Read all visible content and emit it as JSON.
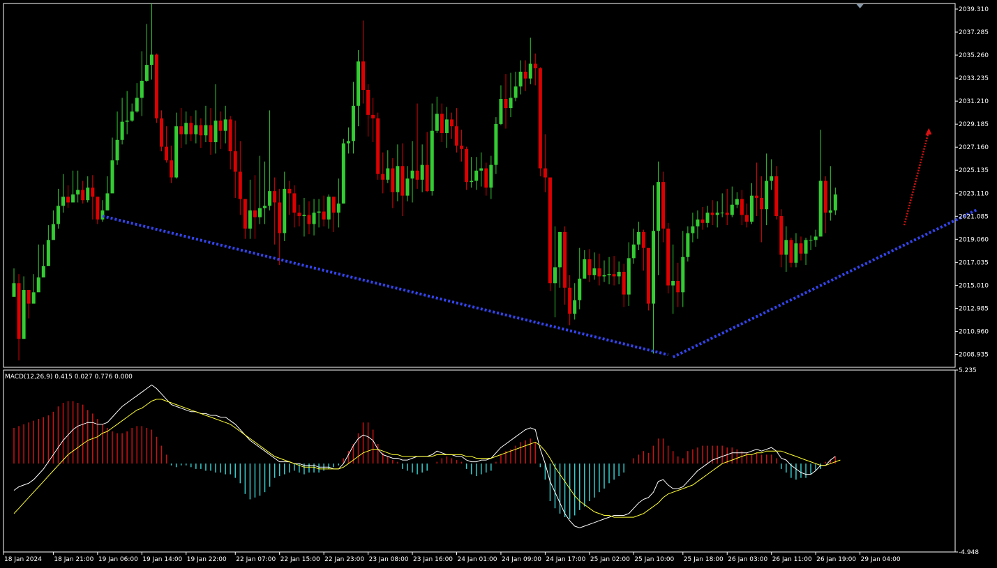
{
  "colors": {
    "background": "#000000",
    "frame": "#ffffff",
    "bull": "#33cc33",
    "bear": "#dd0000",
    "trendline": "#3344ee",
    "projection": "#dd1111",
    "macd_pos": "#cc1111",
    "macd_neg": "#33cccc",
    "macd_line": "#ffffff",
    "signal_line": "#ffff33"
  },
  "indicator": {
    "title": "MACD(12,26,9) 0.415 0.027 0.776 0.000"
  },
  "chart_data": [
    {
      "type": "candlestick",
      "symbol": "",
      "ylim": [
        2007.8,
        2039.8
      ],
      "yticks": [
        "2039.310",
        "2037.285",
        "2035.260",
        "2033.235",
        "2031.210",
        "2029.185",
        "2027.160",
        "2025.135",
        "2023.110",
        "2021.085",
        "2019.060",
        "2017.035",
        "2015.010",
        "2012.985",
        "2010.960",
        "2008.935"
      ],
      "xticks": [
        "18 Jan 2024",
        "18 Jan 21:00",
        "19 Jan 06:00",
        "19 Jan 14:00",
        "19 Jan 22:00",
        "22 Jan 07:00",
        "22 Jan 15:00",
        "22 Jan 23:00",
        "23 Jan 08:00",
        "23 Jan 16:00",
        "24 Jan 01:00",
        "24 Jan 09:00",
        "24 Jan 17:00",
        "25 Jan 02:00",
        "25 Jan 10:00",
        "25 Jan 18:00",
        "26 Jan 03:00",
        "26 Jan 11:00",
        "26 Jan 19:00",
        "29 Jan 04:00"
      ],
      "closes": [
        2015.2,
        2010.3,
        2014.6,
        2013.4,
        2014.4,
        2015.7,
        2016.7,
        2019.0,
        2020.4,
        2022.0,
        2022.8,
        2022.3,
        2023.0,
        2023.4,
        2022.5,
        2023.6,
        2022.8,
        2020.8,
        2021.6,
        2023.1,
        2026.0,
        2027.8,
        2029.4,
        2029.5,
        2030.3,
        2031.5,
        2033.0,
        2034.4,
        2035.3,
        2029.7,
        2027.2,
        2026.0,
        2024.5,
        2029.0,
        2028.3,
        2029.3,
        2028.3,
        2029.1,
        2028.2,
        2029.1,
        2027.6,
        2029.5,
        2028.6,
        2029.6,
        2026.8,
        2025.0,
        2022.6,
        2020.0,
        2021.6,
        2021.0,
        2021.8,
        2022.0,
        2023.3,
        2022.3,
        2019.6,
        2023.5,
        2023.1,
        2021.4,
        2021.1,
        2021.2,
        2020.4,
        2021.4,
        2021.5,
        2020.8,
        2022.8,
        2021.4,
        2022.2,
        2027.5,
        2027.7,
        2030.8,
        2034.7,
        2032.2,
        2030.0,
        2029.7,
        2024.8,
        2024.3,
        2025.3,
        2023.2,
        2025.5,
        2022.9,
        2024.4,
        2025.1,
        2024.3,
        2025.6,
        2023.3,
        2028.6,
        2030.1,
        2028.4,
        2029.6,
        2029.0,
        2027.3,
        2027.0,
        2024.1,
        2024.2,
        2025.1,
        2025.3,
        2023.6,
        2025.6,
        2029.2,
        2031.4,
        2030.6,
        2031.5,
        2032.5,
        2033.8,
        2033.2,
        2034.5,
        2034.1,
        2025.3,
        2024.5,
        2015.2,
        2016.6,
        2019.7,
        2014.8,
        2012.5,
        2013.7,
        2015.6,
        2017.3,
        2015.9,
        2016.5,
        2015.8,
        2015.9,
        2016.0,
        2015.8,
        2016.2,
        2014.2,
        2017.4,
        2018.6,
        2019.7,
        2018.3,
        2013.4,
        2019.8,
        2024.1,
        2020.0,
        2015.0,
        2015.4,
        2014.4,
        2017.5,
        2019.6,
        2020.2,
        2020.8,
        2020.5,
        2021.4,
        2021.2,
        2021.4,
        2021.4,
        2021.2,
        2022.1,
        2022.6,
        2021.2,
        2020.6,
        2022.9,
        2022.7,
        2021.7,
        2024.2,
        2024.6,
        2021.1,
        2017.7,
        2019.0,
        2017.0,
        2018.7,
        2017.8,
        2019.0,
        2019.0,
        2019.3,
        2024.2,
        2021.4,
        2021.6,
        2023.0
      ],
      "highs": [
        2016.5,
        2016.0,
        2015.8,
        2014.5,
        2016.0,
        2018.6,
        2018.6,
        2020.3,
        2021.6,
        2023.5,
        2024.8,
        2023.8,
        2025.1,
        2025.1,
        2024.2,
        2024.6,
        2024.7,
        2022.8,
        2022.5,
        2024.6,
        2028.0,
        2030.3,
        2031.5,
        2032.1,
        2031.0,
        2032.8,
        2035.6,
        2038.0,
        2039.8,
        2035.4,
        2030.4,
        2029.0,
        2027.3,
        2030.2,
        2030.6,
        2030.3,
        2029.9,
        2030.4,
        2029.7,
        2030.8,
        2030.6,
        2032.7,
        2030.3,
        2030.8,
        2029.9,
        2029.5,
        2027.7,
        2022.5,
        2024.3,
        2024.7,
        2026.4,
        2025.9,
        2030.4,
        2024.5,
        2023.5,
        2025.0,
        2024.2,
        2023.8,
        2022.1,
        2022.7,
        2022.4,
        2022.6,
        2022.6,
        2022.9,
        2023.0,
        2022.8,
        2024.4,
        2027.9,
        2028.9,
        2032.9,
        2035.7,
        2038.3,
        2032.7,
        2031.5,
        2030.2,
        2026.7,
        2026.9,
        2026.2,
        2027.4,
        2027.5,
        2025.5,
        2027.7,
        2031.0,
        2027.4,
        2028.5,
        2031.0,
        2031.6,
        2031.0,
        2030.7,
        2030.2,
        2030.6,
        2028.7,
        2027.2,
        2026.3,
        2026.3,
        2026.7,
        2025.8,
        2026.4,
        2029.8,
        2032.6,
        2033.6,
        2033.7,
        2033.8,
        2034.8,
        2034.8,
        2036.8,
        2035.4,
        2034.2,
        2028.3,
        2018.0,
        2020.2,
        2019.7,
        2020.2,
        2015.9,
        2015.2,
        2018.3,
        2018.1,
        2018.2,
        2017.9,
        2017.8,
        2017.2,
        2017.5,
        2017.6,
        2017.1,
        2016.9,
        2018.8,
        2020.0,
        2020.6,
        2019.9,
        2017.3,
        2023.8,
        2025.9,
        2025.0,
        2020.5,
        2018.6,
        2017.0,
        2019.8,
        2020.2,
        2021.4,
        2021.6,
        2021.9,
        2022.0,
        2022.5,
        2022.4,
        2023.1,
        2023.5,
        2023.7,
        2023.2,
        2023.4,
        2022.2,
        2024.0,
        2025.8,
        2024.6,
        2026.6,
        2026.1,
        2025.5,
        2021.7,
        2020.2,
        2019.2,
        2019.6,
        2019.3,
        2019.2,
        2019.4,
        2019.9,
        2028.7,
        2024.6,
        2025.5,
        2023.6
      ],
      "lows": [
        2014.3,
        2008.4,
        2010.3,
        2012.1,
        2013.6,
        2014.5,
        2016.3,
        2018.6,
        2019.9,
        2020.0,
        2021.4,
        2021.8,
        2022.5,
        2022.3,
        2022.2,
        2022.3,
        2020.8,
        2020.4,
        2020.6,
        2021.6,
        2023.4,
        2025.6,
        2027.4,
        2028.3,
        2029.4,
        2030.2,
        2029.9,
        2032.9,
        2033.1,
        2029.3,
        2026.8,
        2025.8,
        2024.0,
        2024.4,
        2027.1,
        2027.4,
        2027.7,
        2027.5,
        2027.1,
        2027.6,
        2026.5,
        2026.6,
        2027.0,
        2027.5,
        2025.2,
        2022.7,
        2021.2,
        2019.1,
        2019.1,
        2019.1,
        2020.4,
        2020.4,
        2021.6,
        2018.6,
        2016.8,
        2018.9,
        2021.2,
        2020.1,
        2020.2,
        2019.3,
        2019.5,
        2019.4,
        2020.1,
        2020.2,
        2020.0,
        2019.7,
        2020.1,
        2022.2,
        2026.6,
        2026.6,
        2029.0,
        2031.0,
        2028.1,
        2027.6,
        2024.3,
        2023.1,
        2024.0,
        2021.8,
        2022.4,
        2021.1,
        2022.4,
        2022.3,
        2023.5,
        2023.2,
        2023.2,
        2022.9,
        2028.4,
        2027.6,
        2027.1,
        2027.9,
        2026.7,
        2025.9,
        2023.4,
        2023.6,
        2023.4,
        2023.7,
        2022.9,
        2022.6,
        2024.8,
        2029.1,
        2028.8,
        2029.8,
        2031.2,
        2031.8,
        2032.1,
        2032.7,
        2032.6,
        2024.6,
        2023.2,
        2014.5,
        2012.2,
        2014.8,
        2013.3,
        2011.5,
        2012.0,
        2012.9,
        2016.0,
        2015.3,
        2015.5,
        2015.0,
        2015.3,
        2015.1,
        2015.0,
        2015.1,
        2013.1,
        2013.2,
        2016.9,
        2018.1,
        2016.3,
        2012.8,
        2009.0,
        2015.9,
        2018.8,
        2014.3,
        2012.5,
        2013.1,
        2013.1,
        2017.1,
        2018.8,
        2019.1,
        2019.9,
        2020.1,
        2020.3,
        2020.1,
        2021.0,
        2020.3,
        2021.0,
        2021.8,
        2020.3,
        2020.1,
        2020.4,
        2021.1,
        2018.8,
        2020.3,
        2023.4,
        2020.8,
        2016.6,
        2016.2,
        2016.6,
        2016.6,
        2017.2,
        2016.8,
        2018.1,
        2018.4,
        2019.3,
        2019.6,
        2020.7,
        2021.2
      ]
    },
    {
      "type": "bar",
      "name": "MACD(12,26,9)",
      "ylim": [
        -4.948,
        5.235
      ],
      "yticks": [
        "5.235",
        "-4.948"
      ],
      "histogram": [
        2.0,
        2.1,
        2.2,
        2.3,
        2.4,
        2.5,
        2.6,
        2.7,
        2.9,
        3.2,
        3.4,
        3.5,
        3.5,
        3.4,
        3.3,
        3.0,
        2.8,
        2.5,
        2.2,
        2.0,
        1.8,
        1.7,
        1.7,
        1.8,
        2.0,
        2.1,
        2.1,
        2.0,
        1.9,
        1.5,
        1.0,
        0.5,
        -0.1,
        -0.2,
        -0.1,
        -0.1,
        -0.2,
        -0.3,
        -0.3,
        -0.4,
        -0.4,
        -0.5,
        -0.5,
        -0.6,
        -0.6,
        -0.8,
        -1.1,
        -1.7,
        -2.0,
        -1.9,
        -1.8,
        -1.6,
        -1.3,
        -0.8,
        -0.7,
        -0.6,
        -0.5,
        -0.4,
        -0.5,
        -0.6,
        -0.5,
        -0.5,
        -0.5,
        -0.4,
        -0.3,
        -0.2,
        -0.1,
        0.3,
        0.7,
        1.1,
        1.7,
        2.3,
        2.3,
        1.9,
        1.1,
        0.6,
        0.4,
        0.2,
        0.1,
        -0.3,
        -0.4,
        -0.5,
        -0.6,
        -0.5,
        -0.4,
        0.0,
        0.1,
        0.3,
        0.4,
        0.3,
        0.2,
        0.1,
        -0.3,
        -0.6,
        -0.7,
        -0.6,
        -0.5,
        -0.4,
        0.1,
        0.5,
        0.7,
        0.8,
        1.0,
        1.2,
        1.3,
        1.4,
        1.2,
        -0.2,
        -0.9,
        -2.1,
        -2.5,
        -2.8,
        -3.0,
        -3.1,
        -2.9,
        -2.6,
        -2.4,
        -2.1,
        -1.9,
        -1.6,
        -1.4,
        -1.1,
        -0.9,
        -0.7,
        -0.5,
        0.0,
        0.3,
        0.5,
        0.7,
        0.6,
        1.0,
        1.4,
        1.4,
        1.0,
        0.7,
        0.4,
        0.3,
        0.7,
        0.8,
        0.9,
        1.0,
        1.0,
        1.0,
        1.0,
        1.0,
        0.9,
        0.9,
        0.8,
        0.7,
        0.6,
        0.5,
        0.6,
        0.5,
        0.5,
        0.5,
        0.3,
        -0.3,
        -0.5,
        -0.8,
        -0.9,
        -0.8,
        -0.8,
        -0.6,
        -0.4,
        -0.3,
        0.1,
        0.2,
        0.4
      ],
      "macd_line": [
        -1.5,
        -1.3,
        -1.2,
        -1.1,
        -0.9,
        -0.6,
        -0.3,
        0.1,
        0.5,
        0.9,
        1.3,
        1.6,
        1.9,
        2.1,
        2.2,
        2.3,
        2.3,
        2.2,
        2.2,
        2.3,
        2.6,
        2.9,
        3.2,
        3.4,
        3.6,
        3.8,
        4.0,
        4.2,
        4.4,
        4.2,
        3.9,
        3.6,
        3.3,
        3.2,
        3.1,
        3.0,
        2.9,
        2.9,
        2.8,
        2.8,
        2.7,
        2.7,
        2.6,
        2.6,
        2.4,
        2.2,
        1.9,
        1.6,
        1.3,
        1.1,
        0.9,
        0.7,
        0.5,
        0.3,
        0.1,
        0.1,
        0.1,
        0.0,
        0.0,
        -0.1,
        -0.1,
        -0.1,
        -0.2,
        -0.2,
        -0.2,
        -0.3,
        -0.3,
        0.0,
        0.5,
        1.0,
        1.4,
        1.6,
        1.5,
        1.3,
        0.8,
        0.5,
        0.4,
        0.3,
        0.3,
        0.2,
        0.2,
        0.3,
        0.4,
        0.4,
        0.4,
        0.5,
        0.7,
        0.6,
        0.5,
        0.5,
        0.4,
        0.4,
        0.2,
        0.1,
        0.1,
        0.2,
        0.2,
        0.3,
        0.6,
        0.9,
        1.1,
        1.3,
        1.5,
        1.7,
        1.9,
        2.0,
        1.9,
        0.8,
        0.0,
        -1.0,
        -1.6,
        -2.2,
        -2.8,
        -3.2,
        -3.5,
        -3.6,
        -3.5,
        -3.4,
        -3.3,
        -3.2,
        -3.1,
        -3.0,
        -2.9,
        -2.9,
        -2.9,
        -2.8,
        -2.5,
        -2.2,
        -2.0,
        -1.9,
        -1.6,
        -1.0,
        -0.9,
        -1.2,
        -1.4,
        -1.4,
        -1.3,
        -1.0,
        -0.7,
        -0.4,
        -0.2,
        0.0,
        0.2,
        0.3,
        0.4,
        0.5,
        0.6,
        0.6,
        0.6,
        0.6,
        0.7,
        0.8,
        0.7,
        0.8,
        0.9,
        0.7,
        0.3,
        0.2,
        -0.1,
        -0.3,
        -0.5,
        -0.6,
        -0.6,
        -0.4,
        -0.1,
        -0.1,
        0.2,
        0.4
      ],
      "signal_line": [
        -2.8,
        -2.5,
        -2.2,
        -1.9,
        -1.6,
        -1.3,
        -1.0,
        -0.7,
        -0.4,
        -0.1,
        0.2,
        0.5,
        0.7,
        0.9,
        1.1,
        1.3,
        1.4,
        1.5,
        1.7,
        1.8,
        2.0,
        2.2,
        2.4,
        2.6,
        2.8,
        3.0,
        3.1,
        3.3,
        3.5,
        3.6,
        3.6,
        3.5,
        3.4,
        3.3,
        3.2,
        3.1,
        3.0,
        2.9,
        2.8,
        2.7,
        2.6,
        2.5,
        2.4,
        2.3,
        2.2,
        2.0,
        1.8,
        1.6,
        1.4,
        1.2,
        1.0,
        0.8,
        0.6,
        0.4,
        0.3,
        0.2,
        0.1,
        0.0,
        -0.1,
        -0.2,
        -0.2,
        -0.2,
        -0.3,
        -0.3,
        -0.3,
        -0.3,
        -0.3,
        -0.2,
        0.0,
        0.2,
        0.4,
        0.6,
        0.7,
        0.8,
        0.8,
        0.7,
        0.6,
        0.5,
        0.5,
        0.4,
        0.4,
        0.4,
        0.4,
        0.4,
        0.4,
        0.4,
        0.5,
        0.5,
        0.5,
        0.5,
        0.5,
        0.5,
        0.4,
        0.4,
        0.3,
        0.3,
        0.3,
        0.3,
        0.4,
        0.5,
        0.6,
        0.7,
        0.8,
        0.9,
        1.0,
        1.1,
        1.2,
        1.0,
        0.7,
        0.3,
        -0.2,
        -0.6,
        -1.0,
        -1.4,
        -1.8,
        -2.1,
        -2.3,
        -2.5,
        -2.7,
        -2.8,
        -2.9,
        -2.9,
        -3.0,
        -3.0,
        -3.0,
        -3.0,
        -3.0,
        -2.9,
        -2.8,
        -2.6,
        -2.4,
        -2.2,
        -1.9,
        -1.7,
        -1.6,
        -1.5,
        -1.4,
        -1.3,
        -1.2,
        -1.0,
        -0.8,
        -0.6,
        -0.4,
        -0.2,
        0.0,
        0.1,
        0.2,
        0.3,
        0.4,
        0.5,
        0.5,
        0.6,
        0.6,
        0.7,
        0.7,
        0.7,
        0.7,
        0.6,
        0.5,
        0.4,
        0.3,
        0.2,
        0.1,
        0.0,
        -0.1,
        -0.1,
        0.0,
        0.1,
        0.2
      ]
    }
  ]
}
